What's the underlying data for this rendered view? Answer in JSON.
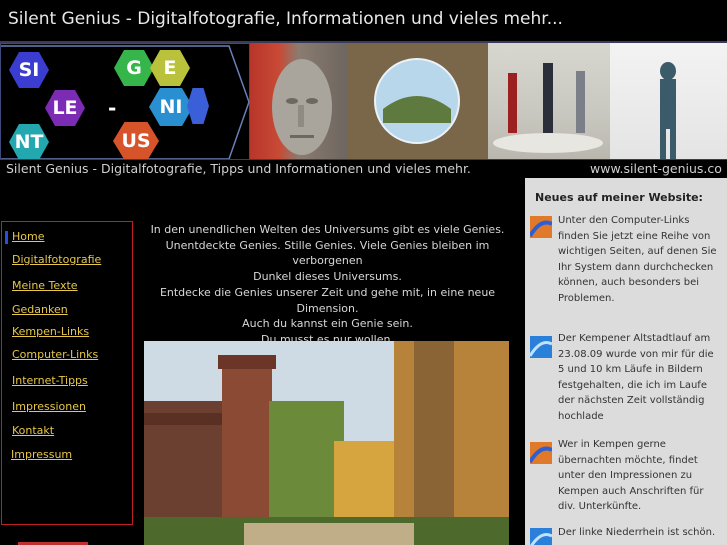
{
  "site": {
    "title": "Silent Genius - Digitalfotografie, Informationen und vieles mehr...",
    "tagline": "Silent Genius - Digitalfotografie, Tipps und Informationen und vieles mehr.",
    "url": "www.silent-genius.co"
  },
  "logo": {
    "letters": [
      "SI",
      "G",
      "E",
      "LE",
      "NI",
      "NT",
      "US"
    ],
    "dash": "-"
  },
  "nav": {
    "items": [
      "Home",
      "Digitalfotografie",
      "Meine Texte",
      "Gedanken",
      "Kempen-Links",
      "Computer-Links",
      "Internet-Tipps",
      "Impressionen",
      "Kontakt",
      "Impressum"
    ],
    "active": "Home"
  },
  "intro": {
    "lines": [
      "In den unendlichen Welten des Universums gibt es viele Genies.",
      "Unentdeckte Genies. Stille Genies. Viele Genies bleiben im verborgenen",
      "Dunkel dieses Universums.",
      "Entdecke die Genies unserer Zeit und gehe mit, in eine neue Dimension.",
      "Auch du kannst ein Genie sein.",
      "Du musst es nur wollen."
    ]
  },
  "news": {
    "title": "Neues auf meiner Website:",
    "entries": [
      "Unter den Computer-Links finden Sie jetzt eine Reihe von wichtigen Seiten, auf denen Sie Ihr System dann durchchecken können, auch besonders bei Problemen.",
      "Der Kempener Altstadtlauf am 23.08.09 wurde von mir für die 5 und 10 km Läufe in Bildern festgehalten, die ich im Laufe der nächsten Zeit vollständig hochlade",
      "Wer in Kempen gerne übernachten möchte, findet unter den Impressionen zu Kempen auch Anschriften für div. Unterkünfte.",
      "Der linke Niederrhein ist schön."
    ]
  },
  "colors": {
    "nav_border": "#c02020",
    "nav_link": "#e6c84a",
    "news_bg": "#dcdcdc",
    "active_marker": "#2a4fd8"
  }
}
